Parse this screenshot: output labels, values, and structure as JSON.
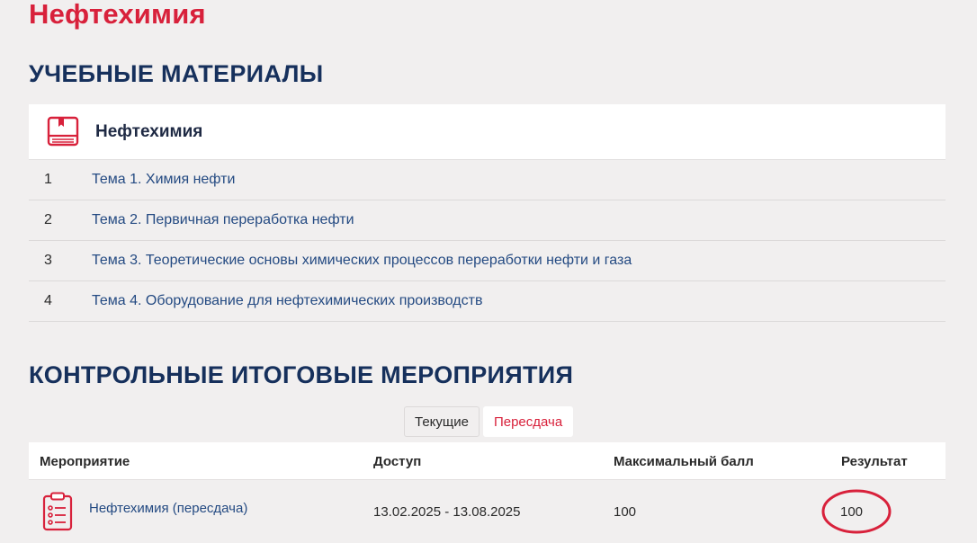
{
  "page": {
    "title": "Нефтехимия"
  },
  "materials": {
    "section_title": "УЧЕБНЫЕ МАТЕРИАЛЫ",
    "course_title": "Нефтехимия",
    "topics": [
      {
        "num": "1",
        "label": "Тема 1. Химия нефти"
      },
      {
        "num": "2",
        "label": "Тема 2. Первичная переработка нефти"
      },
      {
        "num": "3",
        "label": "Тема 3. Теоретические основы химических процессов переработки нефти и газа"
      },
      {
        "num": "4",
        "label": "Тема 4. Оборудование для нефтехимических производств"
      }
    ]
  },
  "events": {
    "section_title": "КОНТРОЛЬНЫЕ ИТОГОВЫЕ МЕРОПРИЯТИЯ",
    "tabs": {
      "current": "Текущие",
      "retake": "Пересдача"
    },
    "columns": {
      "event": "Мероприятие",
      "access": "Доступ",
      "max_score": "Максимальный балл",
      "result": "Результат"
    },
    "rows": [
      {
        "name": "Нефтехимия (пересдача)",
        "access": "13.02.2025 - 13.08.2025",
        "max_score": "100",
        "result": "100"
      }
    ]
  },
  "colors": {
    "accent_red": "#d8213b",
    "heading_navy": "#16305c",
    "link_blue": "#244a82",
    "background": "#f1efef"
  },
  "icons": {
    "course": "book-icon",
    "event": "clipboard-icon",
    "highlight": "red-circle-annotation"
  }
}
